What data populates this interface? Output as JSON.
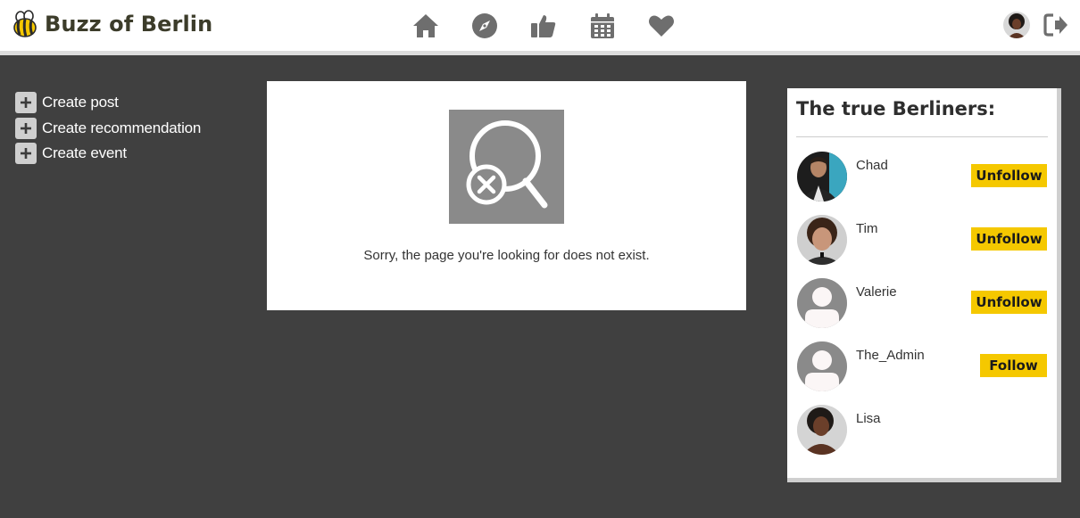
{
  "header": {
    "brand_name": "Buzz of Berlin",
    "nav": [
      {
        "icon": "home-icon"
      },
      {
        "icon": "compass-icon"
      },
      {
        "icon": "thumbs-up-icon"
      },
      {
        "icon": "calendar-icon"
      },
      {
        "icon": "heart-icon"
      }
    ],
    "user_icon": "avatar",
    "logout_icon": "sign-out-icon"
  },
  "actions": [
    {
      "label": "Create post"
    },
    {
      "label": "Create recommendation"
    },
    {
      "label": "Create event"
    }
  ],
  "main": {
    "image_icon": "search-not-found-icon",
    "message": "Sorry, the page you're looking for does not exist."
  },
  "sidebar": {
    "title": "The true Berliners:",
    "users": [
      {
        "name": "Chad",
        "button": "Unfollow"
      },
      {
        "name": "Tim",
        "button": "Unfollow"
      },
      {
        "name": "Valerie",
        "button": "Unfollow"
      },
      {
        "name": "The_Admin",
        "button": "Follow"
      },
      {
        "name": "Lisa",
        "button": ""
      }
    ]
  },
  "colors": {
    "background": "#404040",
    "accent": "#f5c800",
    "icon_gray": "#6e6e6e"
  }
}
